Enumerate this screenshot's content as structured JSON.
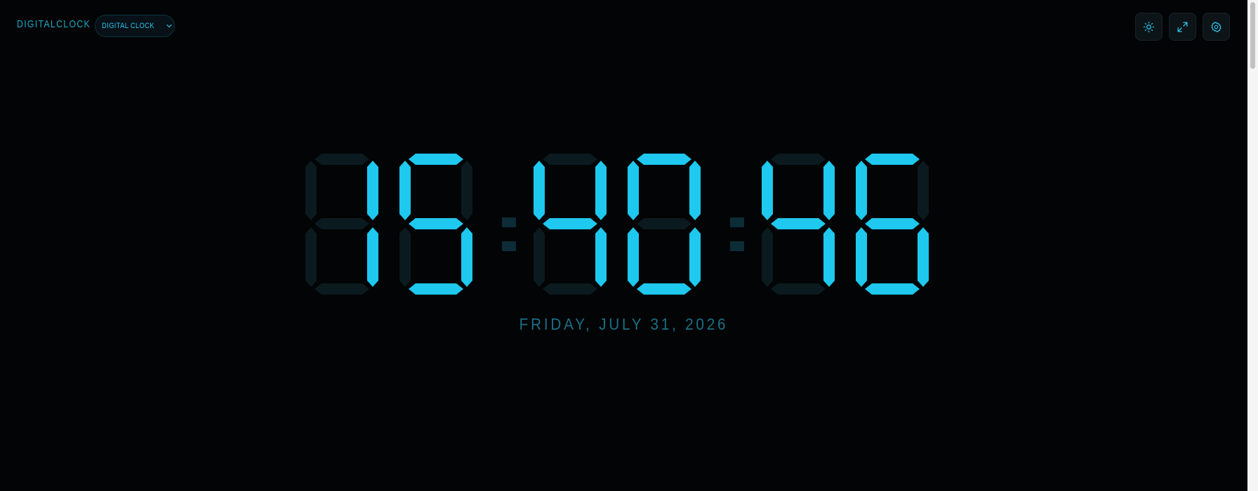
{
  "app": {
    "brand": "DIGITALCLOCK",
    "mode_label": "DIGITAL CLOCK"
  },
  "toolbar": {
    "icons": [
      "sun-icon",
      "expand-icon",
      "gear-icon"
    ]
  },
  "clock": {
    "time": "15:40:46",
    "digits": [
      "1",
      "5",
      "4",
      "0",
      "4",
      "6"
    ],
    "date": "FRIDAY, JULY 31, 2026"
  },
  "colors": {
    "accent": "#1ec8ee",
    "segment_off": "#0b1a1f",
    "background": "#020405",
    "date": "#1b6f87"
  }
}
